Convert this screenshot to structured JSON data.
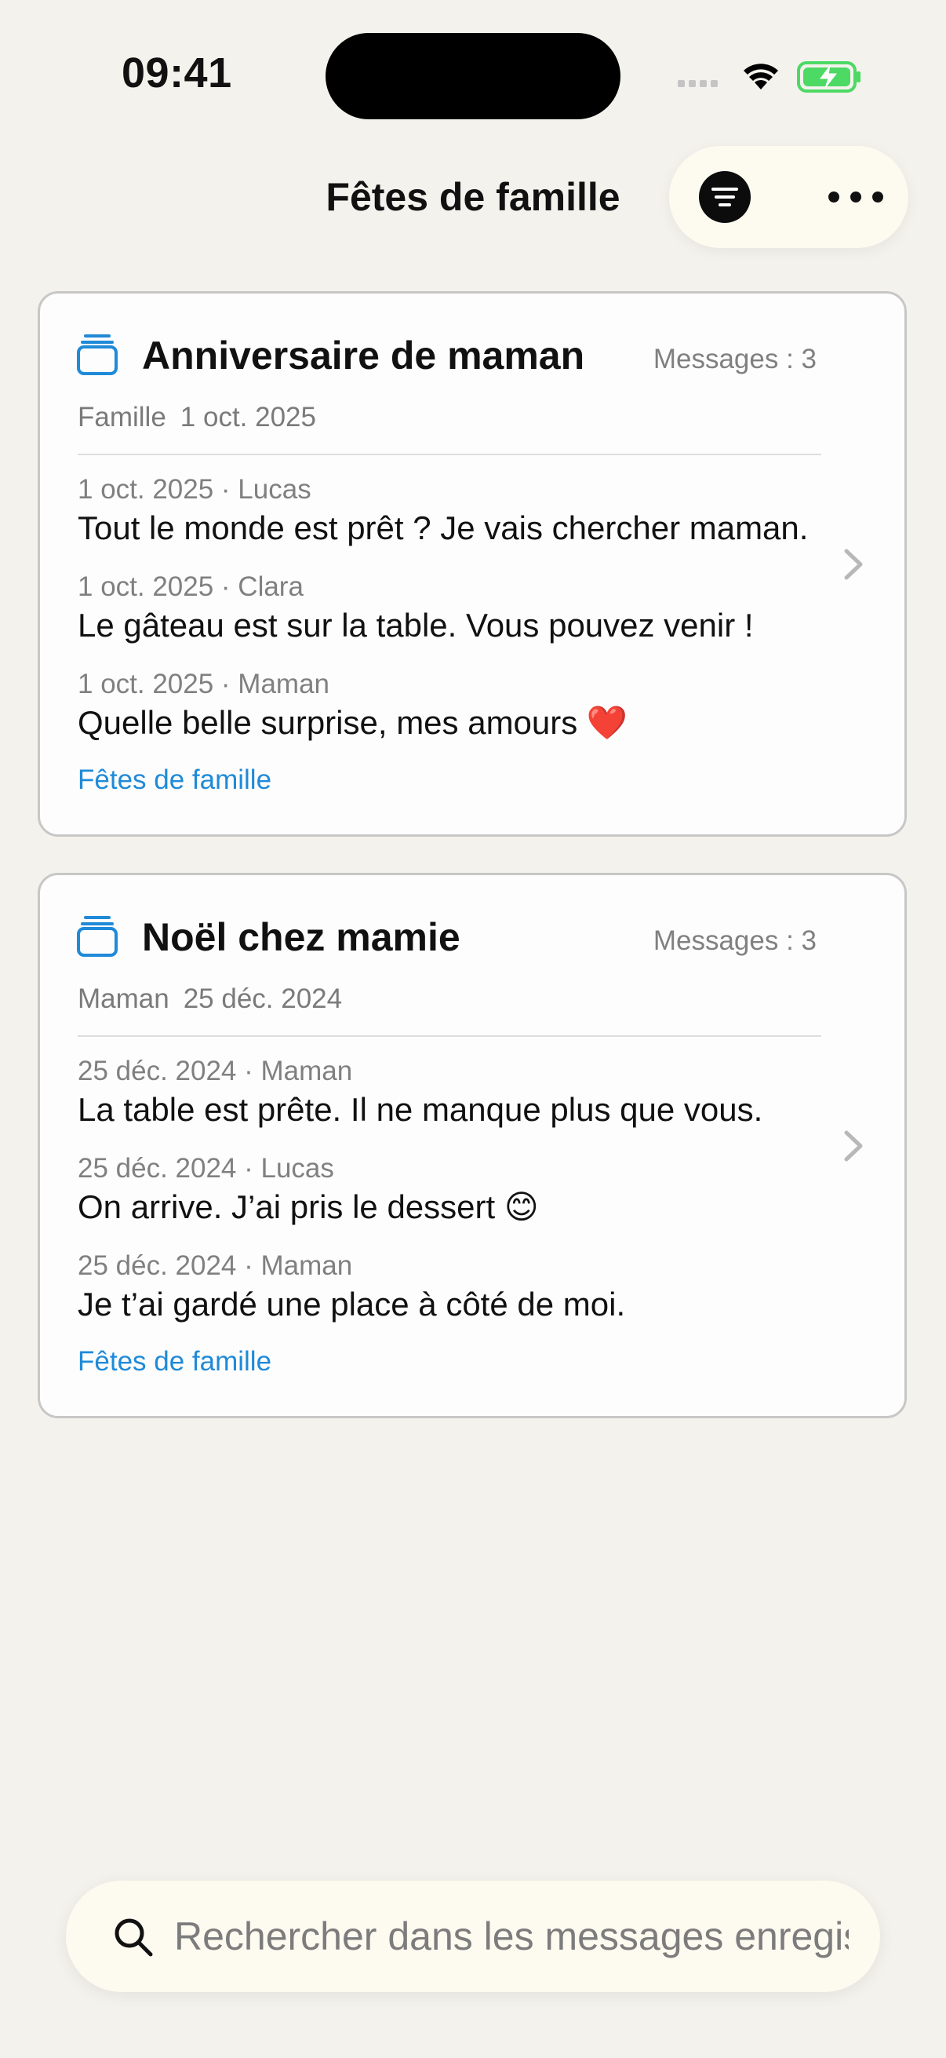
{
  "status_bar": {
    "time": "09:41"
  },
  "nav": {
    "title": "Fêtes de famille",
    "filter_icon": "filter-icon",
    "more_icon": "ellipsis-icon"
  },
  "threads": [
    {
      "icon": "stack-icon",
      "title": "Anniversaire de maman",
      "count_label": "Messages : 3",
      "group": "Famille",
      "date": "1 oct. 2025",
      "messages": [
        {
          "header": "1 oct. 2025 · Lucas",
          "text": "Tout le monde est prêt ? Je vais chercher maman."
        },
        {
          "header": "1 oct. 2025 · Clara",
          "text": "Le gâteau est sur la table. Vous pouvez venir !"
        },
        {
          "header": "1 oct. 2025 · Maman",
          "text": "Quelle belle surprise, mes amours ❤️"
        }
      ],
      "tag": "Fêtes de famille"
    },
    {
      "icon": "stack-icon",
      "title": "Noël chez mamie",
      "count_label": "Messages : 3",
      "group": "Maman",
      "date": "25 déc. 2024",
      "messages": [
        {
          "header": "25 déc. 2024 · Maman",
          "text": "La table est prête. Il ne manque plus que vous."
        },
        {
          "header": "25 déc. 2024 · Lucas",
          "text": "On arrive. J’ai pris le dessert 😊"
        },
        {
          "header": "25 déc. 2024 · Maman",
          "text": "Je t’ai gardé une place à côté de moi."
        }
      ],
      "tag": "Fêtes de famille"
    }
  ],
  "search": {
    "placeholder": "Rechercher dans les messages enregistrés",
    "value": ""
  },
  "colors": {
    "background": "#f4f2ec",
    "accent": "#1f8ad8",
    "card": "#fdfdfd",
    "battery": "#4cd964"
  }
}
